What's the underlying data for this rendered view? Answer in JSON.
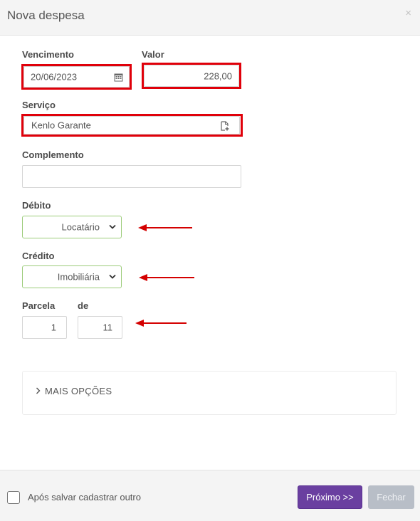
{
  "dialog": {
    "title": "Nova despesa",
    "close_symbol": "×"
  },
  "form": {
    "vencimento": {
      "label": "Vencimento",
      "value": "20/06/2023",
      "icon": "calendar-icon"
    },
    "valor": {
      "label": "Valor",
      "value": "228,00"
    },
    "servico": {
      "label": "Serviço",
      "value": "Kenlo Garante",
      "icon": "document-add-icon"
    },
    "complemento": {
      "label": "Complemento",
      "value": ""
    },
    "debito": {
      "label": "Débito",
      "value": "Locatário"
    },
    "credito": {
      "label": "Crédito",
      "value": "Imobiliária"
    },
    "parcela": {
      "label": "Parcela",
      "value": "1"
    },
    "de": {
      "label": "de",
      "value": "11"
    }
  },
  "more_options": {
    "label": "MAIS OPÇÕES"
  },
  "footer": {
    "checkbox_label": "Após salvar cadastrar outro",
    "next_label": "Próximo >>",
    "close_label": "Fechar"
  },
  "colors": {
    "highlight": "#e0000a",
    "primary": "#6a3fa0",
    "select_border": "#9ccc7a",
    "disabled": "#b8bec7"
  }
}
